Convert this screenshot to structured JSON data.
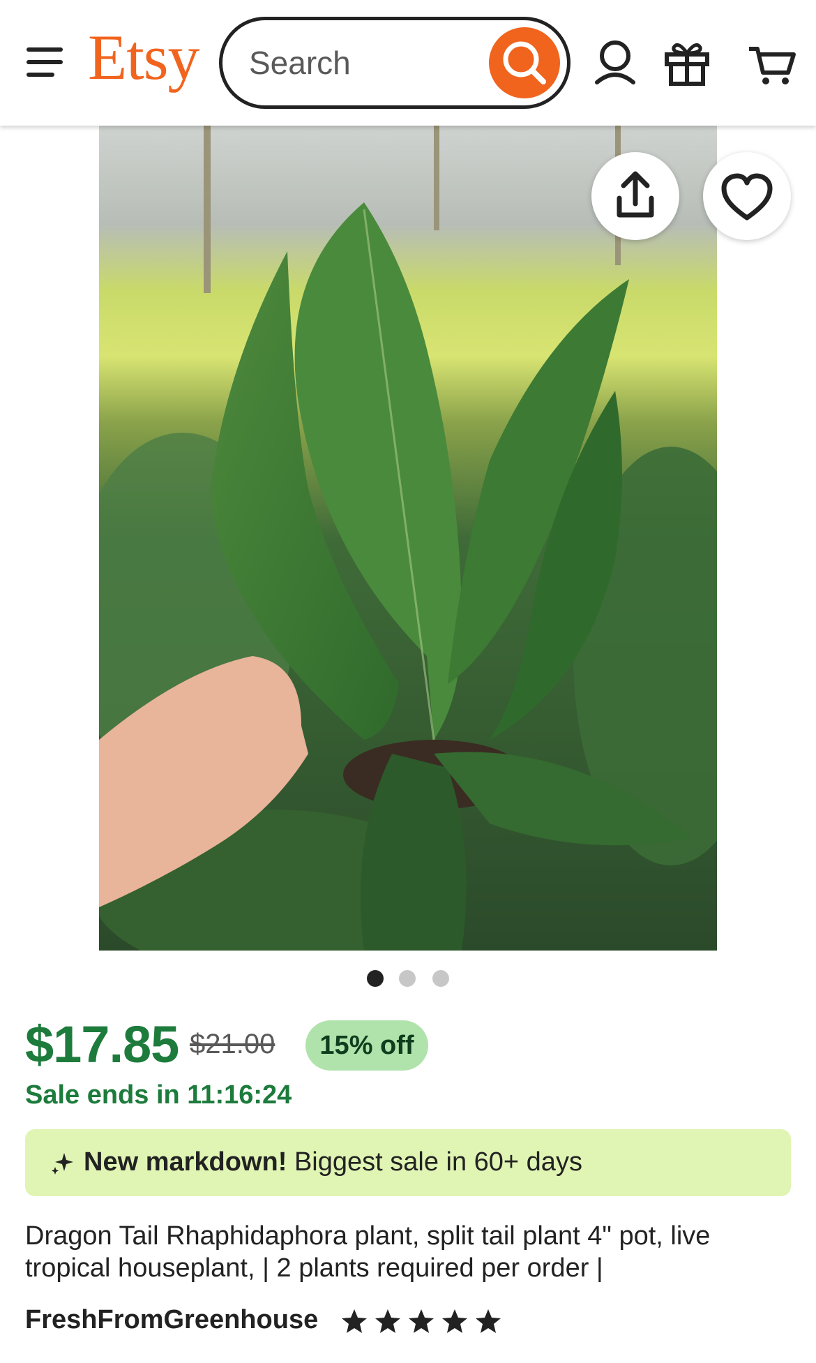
{
  "header": {
    "logo": "Etsy",
    "search_placeholder": "Search",
    "icons": [
      "menu-icon",
      "search-icon",
      "account-icon",
      "gift-icon",
      "cart-icon"
    ],
    "accent_color": "#F1641E"
  },
  "gallery": {
    "photo_alt": "Dragon Tail Rhaphidaphora plant",
    "dots_count": 3,
    "active_dot": 1,
    "buttons": [
      "share-icon",
      "favorite-heart-icon"
    ]
  },
  "pricing": {
    "price": "$17.85",
    "original_price": "$21.00",
    "discount": "15% off",
    "sale_ends": "Sale ends in 11:16:24",
    "price_color": "#1D7B3C"
  },
  "markdown_banner": {
    "bold": "New markdown!",
    "text": " Biggest sale in 60+ days"
  },
  "listing": {
    "title": "Dragon Tail Rhaphidaphora plant, split tail plant 4\" pot, live tropical houseplant, | 2 plants required per order |",
    "shop_name": "FreshFromGreenhouse",
    "rating_stars": 5
  }
}
